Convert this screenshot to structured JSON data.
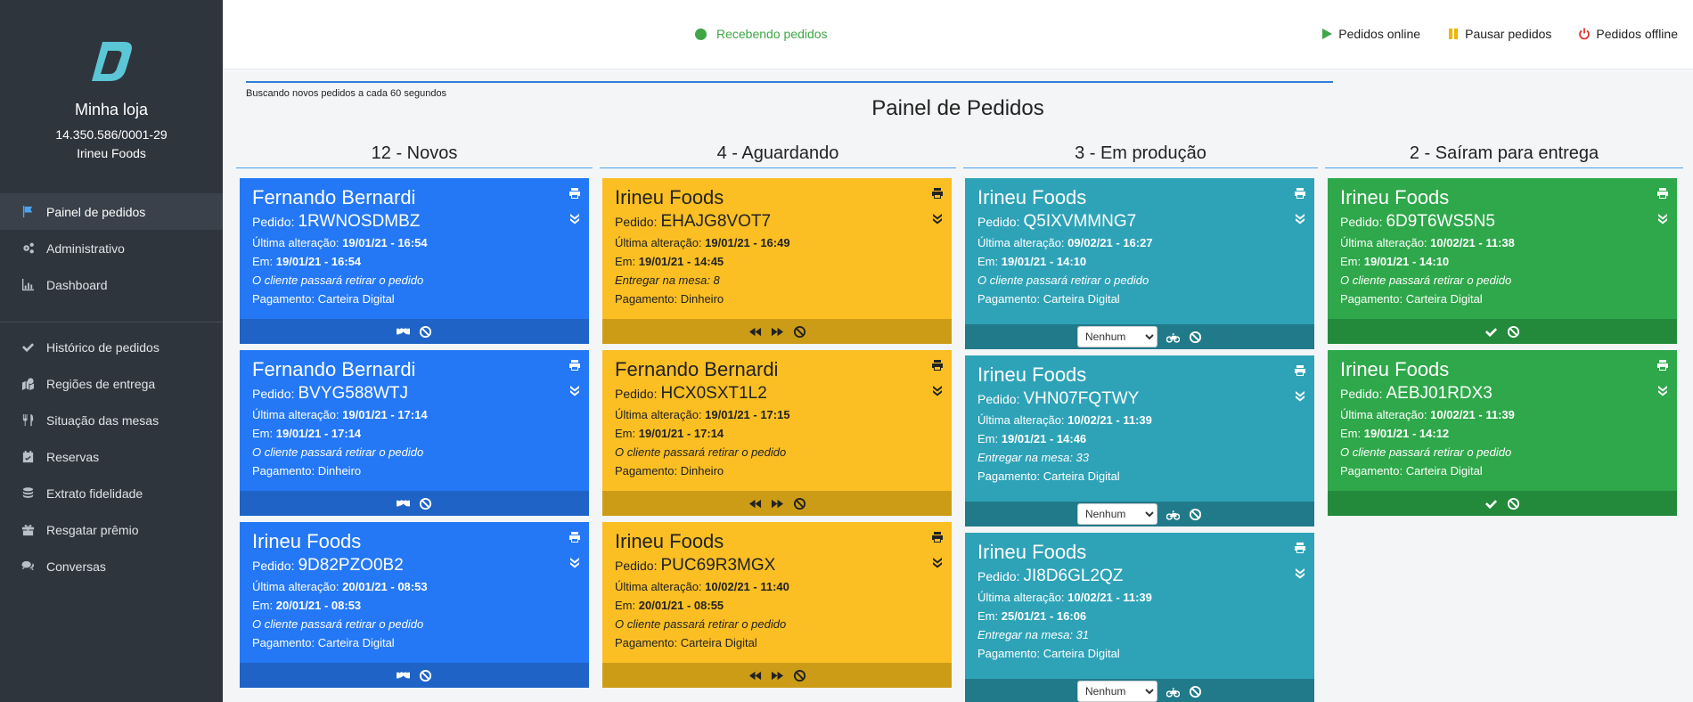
{
  "sidebar": {
    "store_name": "Minha loja",
    "store_doc": "14.350.586/0001-29",
    "store_brand": "Irineu Foods",
    "items_main": [
      {
        "label": "Painel de pedidos",
        "icon": "flag-icon"
      },
      {
        "label": "Administrativo",
        "icon": "cogs-icon"
      },
      {
        "label": "Dashboard",
        "icon": "chart-icon"
      }
    ],
    "items_secondary": [
      {
        "label": "Histórico de pedidos",
        "icon": "check-icon"
      },
      {
        "label": "Regiões de entrega",
        "icon": "map-icon"
      },
      {
        "label": "Situação das mesas",
        "icon": "utensils-icon"
      },
      {
        "label": "Reservas",
        "icon": "calendar-check-icon"
      },
      {
        "label": "Extrato fidelidade",
        "icon": "coins-icon"
      },
      {
        "label": "Resgatar prêmio",
        "icon": "gift-icon"
      },
      {
        "label": "Conversas",
        "icon": "comments-icon"
      }
    ]
  },
  "topbar": {
    "status": "Recebendo pedidos",
    "online": "Pedidos online",
    "pause": "Pausar pedidos",
    "offline": "Pedidos offline",
    "colors": {
      "status": "#3fa648",
      "online": "#3fa648",
      "pause": "#f0b400",
      "offline": "#e3342f"
    }
  },
  "main": {
    "polling": "Buscando novos pedidos a cada 60 segundos",
    "title": "Painel de Pedidos",
    "labels": {
      "order": "Pedido:",
      "last_change": "Última alteração:",
      "at": "Em:"
    },
    "columns": [
      {
        "title": "12 - Novos",
        "cards": [
          {
            "name": "Fernando Bernardi",
            "code": "1RWNOSDMBZ",
            "last": "19/01/21 - 16:54",
            "at": "19/01/21 - 16:54",
            "note": "O cliente passará retirar o pedido",
            "payment": "Pagamento: Carteira Digital"
          },
          {
            "name": "Fernando Bernardi",
            "code": "BVYG588WTJ",
            "last": "19/01/21 - 17:14",
            "at": "19/01/21 - 17:14",
            "note": "O cliente passará retirar o pedido",
            "payment": "Pagamento: Dinheiro"
          },
          {
            "name": "Irineu Foods",
            "code": "9D82PZO0B2",
            "last": "20/01/21 - 08:53",
            "at": "20/01/21 - 08:53",
            "note": "O cliente passará retirar o pedido",
            "payment": "Pagamento: Carteira Digital"
          }
        ]
      },
      {
        "title": "4 - Aguardando",
        "cards": [
          {
            "name": "Irineu Foods",
            "code": "EHAJG8VOT7",
            "last": "19/01/21 - 16:49",
            "at": "19/01/21 - 14:45",
            "note": "Entregar na mesa: 8",
            "payment": "Pagamento: Dinheiro"
          },
          {
            "name": "Fernando Bernardi",
            "code": "HCX0SXT1L2",
            "last": "19/01/21 - 17:15",
            "at": "19/01/21 - 17:14",
            "note": "O cliente passará retirar o pedido",
            "payment": "Pagamento: Dinheiro"
          },
          {
            "name": "Irineu Foods",
            "code": "PUC69R3MGX",
            "last": "10/02/21 - 11:40",
            "at": "20/01/21 - 08:55",
            "note": "O cliente passará retirar o pedido",
            "payment": "Pagamento: Carteira Digital"
          }
        ]
      },
      {
        "title": "3 - Em produção",
        "select": "Nenhum",
        "cards": [
          {
            "name": "Irineu Foods",
            "code": "Q5IXVMMNG7",
            "last": "09/02/21 - 16:27",
            "at": "19/01/21 - 14:10",
            "note": "O cliente passará retirar o pedido",
            "payment": "Pagamento: Carteira Digital"
          },
          {
            "name": "Irineu Foods",
            "code": "VHN07FQTWY",
            "last": "10/02/21 - 11:39",
            "at": "19/01/21 - 14:46",
            "note": "Entregar na mesa: 33",
            "payment": "Pagamento: Carteira Digital"
          },
          {
            "name": "Irineu Foods",
            "code": "JI8D6GL2QZ",
            "last": "10/02/21 - 11:39",
            "at": "25/01/21 - 16:06",
            "note": "Entregar na mesa: 31",
            "payment": "Pagamento: Carteira Digital"
          }
        ]
      },
      {
        "title": "2 - Saíram para entrega",
        "cards": [
          {
            "name": "Irineu Foods",
            "code": "6D9T6WS5N5",
            "last": "10/02/21 - 11:38",
            "at": "19/01/21 - 14:10",
            "note": "O cliente passará retirar o pedido",
            "payment": "Pagamento: Carteira Digital"
          },
          {
            "name": "Irineu Foods",
            "code": "AEBJ01RDX3",
            "last": "10/02/21 - 11:39",
            "at": "19/01/21 - 14:12",
            "note": "O cliente passará retirar o pedido",
            "payment": "Pagamento: Carteira Digital"
          }
        ]
      }
    ]
  }
}
